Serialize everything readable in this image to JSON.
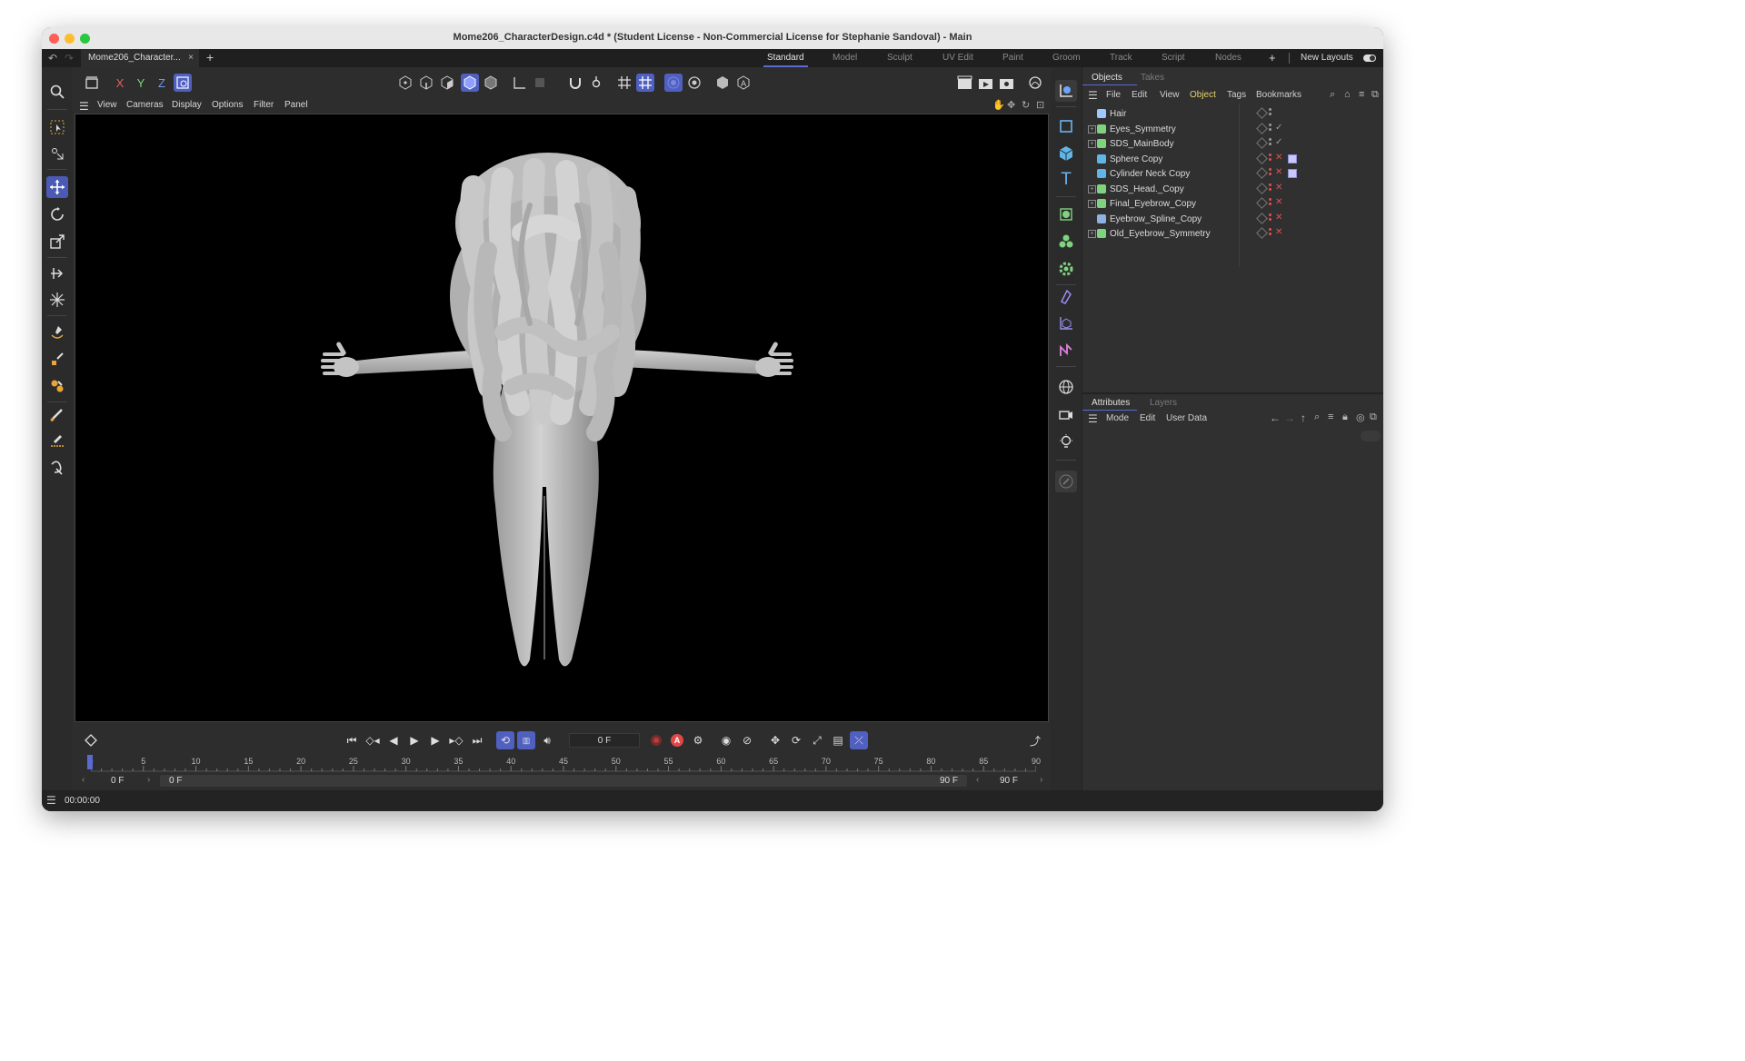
{
  "window": {
    "title": "Mome206_CharacterDesign.c4d * (Student License - Non-Commercial License for Stephanie Sandoval) - Main",
    "document_tab": "Mome206_Character...",
    "document_tab_close": "×",
    "new_tab": "+"
  },
  "layouts": {
    "tabs": [
      "Standard",
      "Model",
      "Sculpt",
      "UV Edit",
      "Paint",
      "Groom",
      "Track",
      "Script",
      "Nodes"
    ],
    "active": "Standard",
    "add": "+",
    "new_layouts": "New Layouts"
  },
  "axis_buttons": {
    "x": "X",
    "y": "Y",
    "z": "Z"
  },
  "viewport_menu": [
    "View",
    "Cameras",
    "Display",
    "Options",
    "Filter",
    "Panel"
  ],
  "objects_panel": {
    "tabs": [
      "Objects",
      "Takes"
    ],
    "menu": [
      "File",
      "Edit",
      "View",
      "Object",
      "Tags",
      "Bookmarks"
    ],
    "menu_highlight": "Object",
    "objects": [
      {
        "name": "Hair",
        "icon_color": "#9ec9ff",
        "expandable": false,
        "status": "",
        "status_color": "#9a9a9a",
        "dots": [
          "#9a9a9a",
          "#9a9a9a"
        ],
        "tag": false
      },
      {
        "name": "Eyes_Symmetry",
        "icon_color": "#7fd37f",
        "expandable": true,
        "status": "✓",
        "status_color": "#9a9a9a",
        "dots": [
          "#9a9a9a",
          "#9a9a9a"
        ],
        "tag": false
      },
      {
        "name": "SDS_MainBody",
        "icon_color": "#7fd37f",
        "expandable": true,
        "status": "✓",
        "status_color": "#9a9a9a",
        "dots": [
          "#9a9a9a",
          "#9a9a9a"
        ],
        "tag": false
      },
      {
        "name": "Sphere Copy",
        "icon_color": "#5fb5e8",
        "expandable": false,
        "status": "✕",
        "status_color": "#e05050",
        "dots": [
          "#e05050",
          "#e05050"
        ],
        "tag": true
      },
      {
        "name": "Cylinder Neck Copy",
        "icon_color": "#5fb5e8",
        "expandable": false,
        "status": "✕",
        "status_color": "#e05050",
        "dots": [
          "#e05050",
          "#e05050"
        ],
        "tag": true
      },
      {
        "name": "SDS_Head._Copy",
        "icon_color": "#7fd37f",
        "expandable": true,
        "status": "✕",
        "status_color": "#e05050",
        "dots": [
          "#e05050",
          "#e05050"
        ],
        "tag": false
      },
      {
        "name": "Final_Eyebrow_Copy",
        "icon_color": "#7fd37f",
        "expandable": true,
        "status": "✕",
        "status_color": "#e05050",
        "dots": [
          "#e05050",
          "#e05050"
        ],
        "tag": false
      },
      {
        "name": "Eyebrow_Spline_Copy",
        "icon_color": "#8fb0e0",
        "expandable": false,
        "status": "✕",
        "status_color": "#e05050",
        "dots": [
          "#e05050",
          "#e05050"
        ],
        "tag": false
      },
      {
        "name": "Old_Eyebrow_Symmetry",
        "icon_color": "#7fd37f",
        "expandable": true,
        "status": "✕",
        "status_color": "#e05050",
        "dots": [
          "#e05050",
          "#e05050"
        ],
        "tag": false
      }
    ]
  },
  "attributes_panel": {
    "tabs": [
      "Attributes",
      "Layers"
    ],
    "menu": [
      "Mode",
      "Edit",
      "User Data"
    ]
  },
  "timeline": {
    "current_frame": "0 F",
    "start_frame": "0 F",
    "range_start": "0 F",
    "range_end": "90 F",
    "end_frame": "90 F",
    "ticks": [
      "0",
      "5",
      "10",
      "15",
      "20",
      "25",
      "30",
      "35",
      "40",
      "45",
      "50",
      "55",
      "60",
      "65",
      "70",
      "75",
      "80",
      "85",
      "90"
    ],
    "record_label": "A"
  },
  "status": {
    "time": "00:00:00"
  }
}
